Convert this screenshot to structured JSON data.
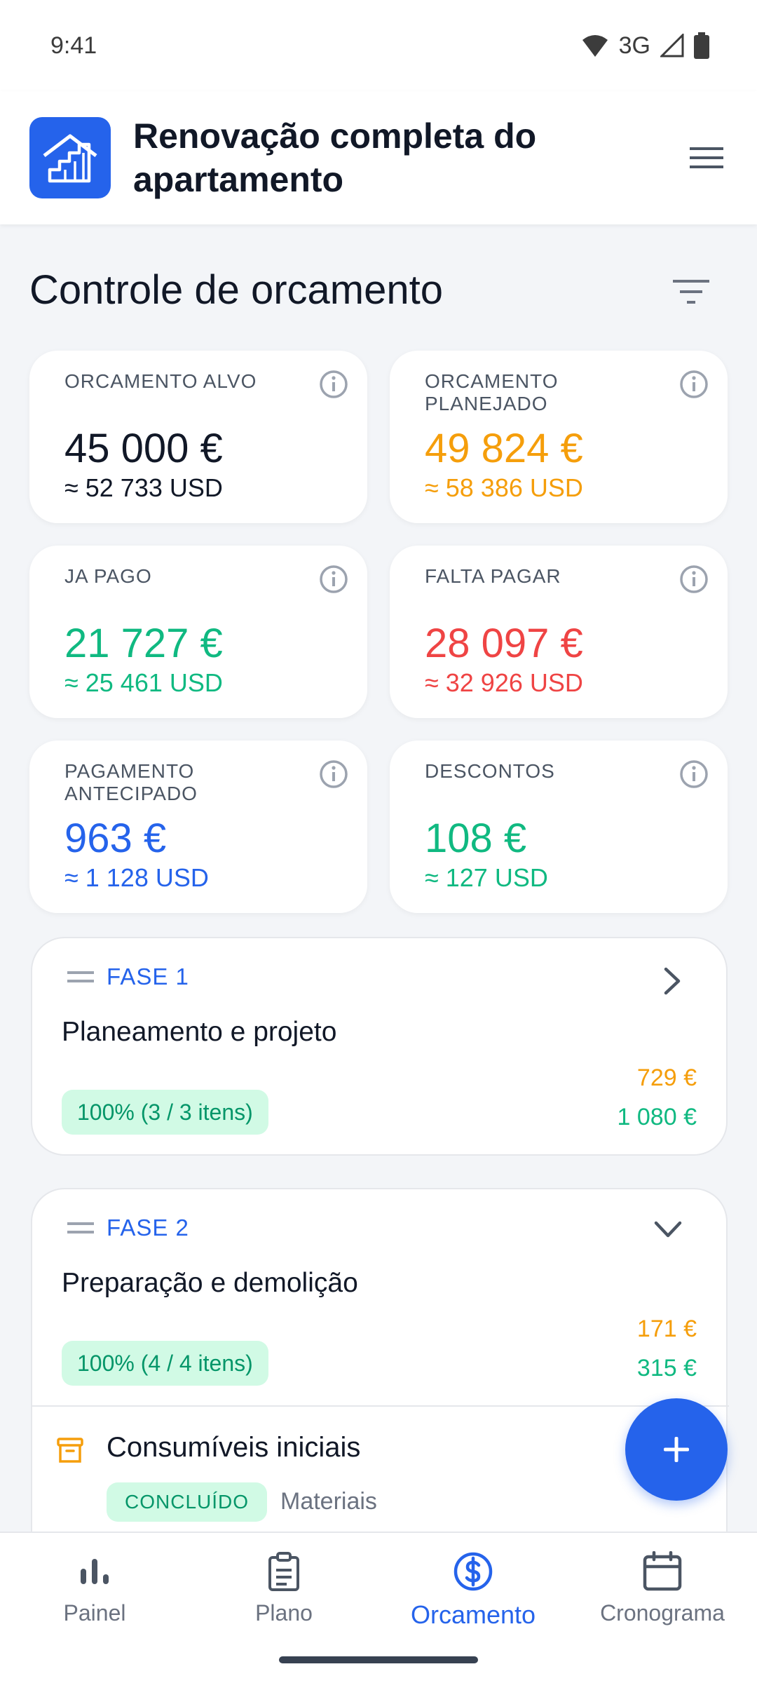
{
  "status_bar": {
    "time": "9:41",
    "network": "3G"
  },
  "app_bar": {
    "title": "Renovação completa do apartamento"
  },
  "section_title": "Controle de orcamento",
  "colors": {
    "primary": "#2563eb",
    "orange": "#f59e0b",
    "green": "#10b981",
    "red": "#ef4444",
    "dark": "#111827"
  },
  "stats": [
    {
      "label": "ORCAMENTO ALVO",
      "amount": "45 000 €",
      "usd": "≈ 52 733 USD",
      "color": "#111827"
    },
    {
      "label": "ORCAMENTO PLANEJADO",
      "amount": "49 824 €",
      "usd": "≈ 58 386 USD",
      "color": "#f59e0b"
    },
    {
      "label": "JA PAGO",
      "amount": "21 727 €",
      "usd": "≈ 25 461 USD",
      "color": "#10b981"
    },
    {
      "label": "FALTA PAGAR",
      "amount": "28 097 €",
      "usd": "≈ 32 926 USD",
      "color": "#ef4444"
    },
    {
      "label": "PAGAMENTO ANTECIPADO",
      "amount": "963 €",
      "usd": "≈ 1 128 USD",
      "color": "#2563eb"
    },
    {
      "label": "DESCONTOS",
      "amount": "108 €",
      "usd": "≈ 127 USD",
      "color": "#10b981"
    }
  ],
  "phases": [
    {
      "label": "FASE 1",
      "name": "Planeamento e projeto",
      "progress": "100% (3 / 3 itens)",
      "planned": "729 €",
      "paid": "1 080 €",
      "expanded": false
    },
    {
      "label": "FASE 2",
      "name": "Preparação e demolição",
      "progress": "100% (4 / 4 itens)",
      "planned": "171 €",
      "paid": "315 €",
      "expanded": true,
      "items": [
        {
          "title": "Consumíveis iniciais",
          "status": "CONCLUÍDO",
          "category": "Materiais"
        }
      ]
    }
  ],
  "nav": [
    {
      "label": "Painel",
      "icon": "bar-chart-icon",
      "active": false
    },
    {
      "label": "Plano",
      "icon": "clipboard-icon",
      "active": false
    },
    {
      "label": "Orcamento",
      "icon": "dollar-circle-icon",
      "active": true
    },
    {
      "label": "Cronograma",
      "icon": "calendar-icon",
      "active": false
    }
  ]
}
